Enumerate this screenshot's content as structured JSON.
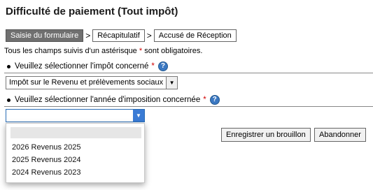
{
  "page": {
    "title": "Difficulté de paiement (Tout impôt)"
  },
  "steps": [
    {
      "label": "Saisie du formulaire",
      "active": true
    },
    {
      "label": "Récapitulatif",
      "active": false
    },
    {
      "label": "Accusé de Réception",
      "active": false
    }
  ],
  "step_separator": ">",
  "required_note": {
    "before": "Tous les champs suivis d'un astérisque ",
    "star": "*",
    "after": " sont obligatoires."
  },
  "questions": {
    "impot": {
      "label": "Veuillez sélectionner l'impôt concerné",
      "star": "*",
      "help_icon": "help-question-icon"
    },
    "annee": {
      "label": "Veuillez sélectionner l'année d'imposition concernée",
      "star": "*",
      "help_icon": "help-question-icon"
    }
  },
  "select_impot": {
    "value": "Impôt sur le Revenu et prélèvements sociaux",
    "arrow": "▼"
  },
  "select_annee": {
    "value": "",
    "arrow": "▼"
  },
  "dropdown": {
    "options": [
      "",
      "2026 Revenus 2025",
      "2025 Revenus 2024",
      "2024 Revenus 2023"
    ]
  },
  "buttons": {
    "draft": "Enregistrer un brouillon",
    "abandon": "Abandonner"
  },
  "colors": {
    "required_star": "#d10000",
    "active_step_bg": "#707070",
    "help_icon": "#3b78c2",
    "select_focus": "#3a7bd5"
  }
}
